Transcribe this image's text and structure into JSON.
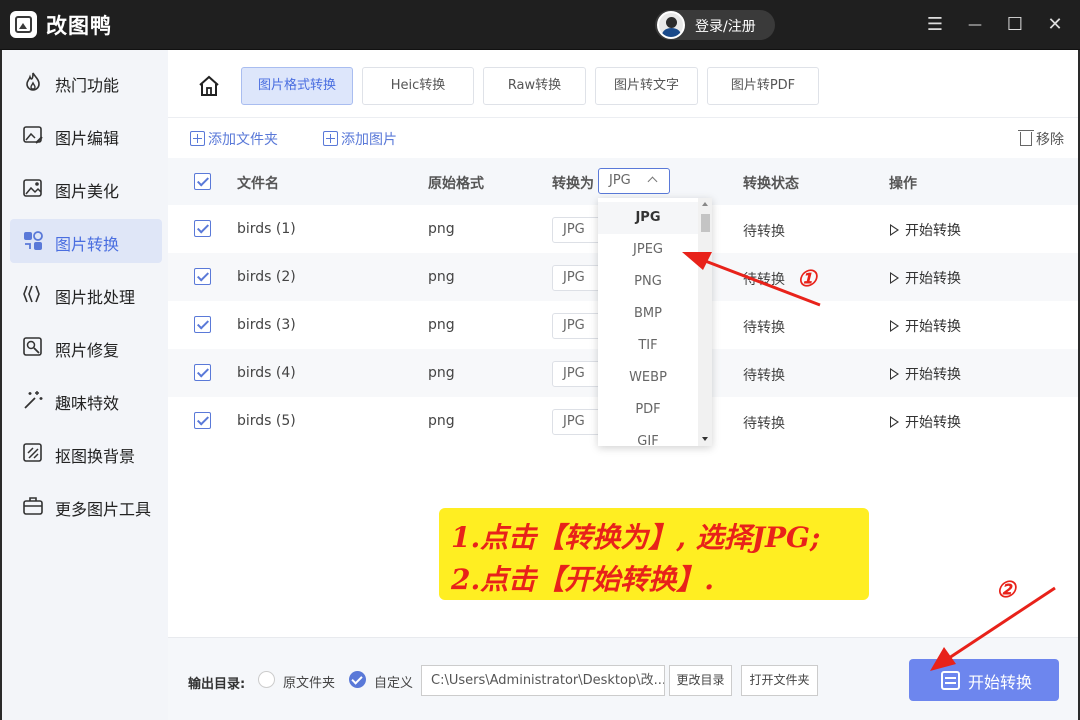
{
  "app": {
    "title": "改图鸭",
    "login_label": "登录/注册"
  },
  "window_controls": {
    "menu": "☰",
    "minimize": "—",
    "maximize": "☐",
    "close": "✕"
  },
  "sidebar": {
    "items": [
      {
        "label": "热门功能",
        "icon": "fire-icon"
      },
      {
        "label": "图片编辑",
        "icon": "image-edit-icon"
      },
      {
        "label": "图片美化",
        "icon": "image-beauty-icon"
      },
      {
        "label": "图片转换",
        "icon": "image-convert-icon",
        "active": true
      },
      {
        "label": "图片批处理",
        "icon": "batch-icon"
      },
      {
        "label": "照片修复",
        "icon": "photo-repair-icon"
      },
      {
        "label": "趣味特效",
        "icon": "magic-icon"
      },
      {
        "label": "抠图换背景",
        "icon": "cutout-icon"
      },
      {
        "label": "更多图片工具",
        "icon": "toolbox-icon"
      }
    ]
  },
  "tabs": [
    {
      "label": "图片格式转换",
      "active": true
    },
    {
      "label": "Heic转换"
    },
    {
      "label": "Raw转换"
    },
    {
      "label": "图片转文字"
    },
    {
      "label": "图片转PDF"
    }
  ],
  "toolbar": {
    "add_folder": "添加文件夹",
    "add_image": "添加图片",
    "remove": "移除"
  },
  "table": {
    "headers": {
      "filename": "文件名",
      "original_format": "原始格式",
      "convert_to": "转换为",
      "status": "转换状态",
      "action": "操作"
    },
    "convert_to_value": "JPG",
    "rows": [
      {
        "filename": "birds (1)",
        "format": "png",
        "target": "JPG",
        "status": "待转换",
        "action": "开始转换"
      },
      {
        "filename": "birds (2)",
        "format": "png",
        "target": "JPG",
        "status": "待转换",
        "action": "开始转换"
      },
      {
        "filename": "birds (3)",
        "format": "png",
        "target": "JPG",
        "status": "待转换",
        "action": "开始转换"
      },
      {
        "filename": "birds (4)",
        "format": "png",
        "target": "JPG",
        "status": "待转换",
        "action": "开始转换"
      },
      {
        "filename": "birds (5)",
        "format": "png",
        "target": "JPG",
        "status": "待转换",
        "action": "开始转换"
      }
    ]
  },
  "dropdown": {
    "options": [
      "JPG",
      "JPEG",
      "PNG",
      "BMP",
      "TIF",
      "WEBP",
      "PDF",
      "GIF"
    ],
    "selected": "JPG"
  },
  "instruction": {
    "line1": "1.点击【转换为】, 选择JPG;",
    "line2": "2.点击【开始转换】."
  },
  "annotations": {
    "marker1": "①",
    "marker2": "②"
  },
  "output": {
    "label": "输出目录:",
    "option_original": "原文件夹",
    "option_custom": "自定义",
    "path": "C:\\Users\\Administrator\\Desktop\\改...",
    "change_dir": "更改目录",
    "open_folder": "打开文件夹",
    "start_button": "开始转换"
  },
  "colors": {
    "accent": "#5a79d8",
    "start_button": "#6d86ee",
    "annotation_red": "#e8221a",
    "note_yellow": "#ffee22"
  }
}
